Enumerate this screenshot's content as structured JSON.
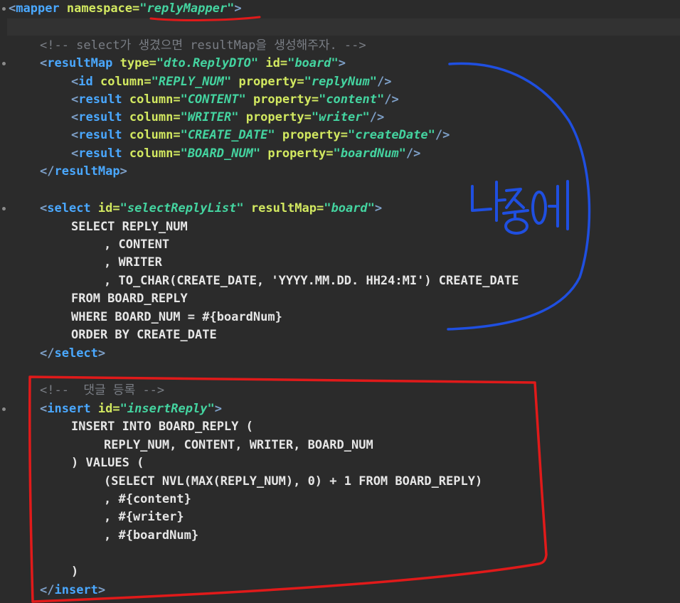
{
  "lines": [
    {
      "key": "mapper_open",
      "parts": [
        [
          "bracket",
          "<"
        ],
        [
          "tag",
          "mapper"
        ],
        [
          "attr",
          " namespace"
        ],
        [
          "eq",
          "="
        ],
        [
          "val",
          "\"replyMapper\""
        ],
        [
          "bracket",
          ">"
        ]
      ]
    },
    {
      "key": "comment_select",
      "parts": [
        [
          "comment",
          "<!-- select가 생겼으면 resultMap을 생성해주자. -->"
        ]
      ]
    },
    {
      "key": "resultmap_open",
      "parts": [
        [
          "bracket",
          "<"
        ],
        [
          "tag",
          "resultMap"
        ],
        [
          "attr",
          " type"
        ],
        [
          "eq",
          "="
        ],
        [
          "val",
          "\"dto.ReplyDTO\""
        ],
        [
          "attr",
          " id"
        ],
        [
          "eq",
          "="
        ],
        [
          "val",
          "\"board\""
        ],
        [
          "bracket",
          ">"
        ]
      ]
    },
    {
      "key": "id_line",
      "parts": [
        [
          "bracket",
          "<"
        ],
        [
          "tag",
          "id"
        ],
        [
          "attr",
          " column"
        ],
        [
          "eq",
          "="
        ],
        [
          "val",
          "\"REPLY_NUM\""
        ],
        [
          "attr",
          " property"
        ],
        [
          "eq",
          "="
        ],
        [
          "val",
          "\"replyNum\""
        ],
        [
          "bracket",
          "/>"
        ]
      ]
    },
    {
      "key": "result_content",
      "parts": [
        [
          "bracket",
          "<"
        ],
        [
          "tag",
          "result"
        ],
        [
          "attr",
          " column"
        ],
        [
          "eq",
          "="
        ],
        [
          "val",
          "\"CONTENT\""
        ],
        [
          "attr",
          " property"
        ],
        [
          "eq",
          "="
        ],
        [
          "val",
          "\"content\""
        ],
        [
          "bracket",
          "/>"
        ]
      ]
    },
    {
      "key": "result_writer",
      "parts": [
        [
          "bracket",
          "<"
        ],
        [
          "tag",
          "result"
        ],
        [
          "attr",
          " column"
        ],
        [
          "eq",
          "="
        ],
        [
          "val",
          "\"WRITER\""
        ],
        [
          "attr",
          " property"
        ],
        [
          "eq",
          "="
        ],
        [
          "val",
          "\"writer\""
        ],
        [
          "bracket",
          "/>"
        ]
      ]
    },
    {
      "key": "result_createdate",
      "parts": [
        [
          "bracket",
          "<"
        ],
        [
          "tag",
          "result"
        ],
        [
          "attr",
          " column"
        ],
        [
          "eq",
          "="
        ],
        [
          "val",
          "\"CREATE_DATE\""
        ],
        [
          "attr",
          " property"
        ],
        [
          "eq",
          "="
        ],
        [
          "val",
          "\"createDate\""
        ],
        [
          "bracket",
          "/>"
        ]
      ]
    },
    {
      "key": "result_boardnum",
      "parts": [
        [
          "bracket",
          "<"
        ],
        [
          "tag",
          "result"
        ],
        [
          "attr",
          " column"
        ],
        [
          "eq",
          "="
        ],
        [
          "val",
          "\"BOARD_NUM\""
        ],
        [
          "attr",
          " property"
        ],
        [
          "eq",
          "="
        ],
        [
          "val",
          "\"boardNum\""
        ],
        [
          "bracket",
          "/>"
        ]
      ]
    },
    {
      "key": "resultmap_close",
      "parts": [
        [
          "bracket",
          "</"
        ],
        [
          "tag",
          "resultMap"
        ],
        [
          "bracket",
          ">"
        ]
      ]
    },
    {
      "key": "select_open",
      "parts": [
        [
          "bracket",
          "<"
        ],
        [
          "tag",
          "select"
        ],
        [
          "attr",
          " id"
        ],
        [
          "eq",
          "="
        ],
        [
          "val",
          "\"selectReplyList\""
        ],
        [
          "attr",
          " resultMap"
        ],
        [
          "eq",
          "="
        ],
        [
          "val",
          "\"board\""
        ],
        [
          "bracket",
          ">"
        ]
      ]
    },
    {
      "key": "sql_select",
      "parts": [
        [
          "sql",
          "SELECT REPLY_NUM"
        ]
      ]
    },
    {
      "key": "sql_content",
      "parts": [
        [
          "sql",
          ", CONTENT"
        ]
      ]
    },
    {
      "key": "sql_writer",
      "parts": [
        [
          "sql",
          ", WRITER"
        ]
      ]
    },
    {
      "key": "sql_tochar",
      "parts": [
        [
          "sql",
          ", TO_CHAR(CREATE_DATE, 'YYYY.MM.DD. HH24:MI') CREATE_DATE"
        ]
      ]
    },
    {
      "key": "sql_from",
      "parts": [
        [
          "sql",
          "FROM BOARD_REPLY"
        ]
      ]
    },
    {
      "key": "sql_where",
      "parts": [
        [
          "sql",
          "WHERE BOARD_NUM = #{boardNum}"
        ]
      ]
    },
    {
      "key": "sql_order",
      "parts": [
        [
          "sql",
          "ORDER BY CREATE_DATE"
        ]
      ]
    },
    {
      "key": "select_close",
      "parts": [
        [
          "bracket",
          "</"
        ],
        [
          "tag",
          "select"
        ],
        [
          "bracket",
          ">"
        ]
      ]
    },
    {
      "key": "comment_insert",
      "parts": [
        [
          "comment",
          "<!--  댓글 등록 -->"
        ]
      ]
    },
    {
      "key": "insert_open",
      "parts": [
        [
          "bracket",
          "<"
        ],
        [
          "tag",
          "insert"
        ],
        [
          "attr",
          " id"
        ],
        [
          "eq",
          "="
        ],
        [
          "val",
          "\"insertReply\""
        ],
        [
          "bracket",
          ">"
        ]
      ]
    },
    {
      "key": "sql_insert",
      "parts": [
        [
          "sql",
          "INSERT INTO BOARD_REPLY ("
        ]
      ]
    },
    {
      "key": "sql_cols",
      "parts": [
        [
          "sql",
          "REPLY_NUM, CONTENT, WRITER, BOARD_NUM"
        ]
      ]
    },
    {
      "key": "sql_values",
      "parts": [
        [
          "sql",
          ") VALUES ("
        ]
      ]
    },
    {
      "key": "sql_subselect",
      "parts": [
        [
          "sql",
          "(SELECT NVL(MAX(REPLY_NUM), 0) + 1 FROM BOARD_REPLY)"
        ]
      ]
    },
    {
      "key": "sql_p_content",
      "parts": [
        [
          "sql",
          ", #{content}"
        ]
      ]
    },
    {
      "key": "sql_p_writer",
      "parts": [
        [
          "sql",
          ", #{writer}"
        ]
      ]
    },
    {
      "key": "sql_p_boardnum",
      "parts": [
        [
          "sql",
          ", #{boardNum}"
        ]
      ]
    },
    {
      "key": "sql_close_paren",
      "parts": [
        [
          "sql",
          ")"
        ]
      ]
    },
    {
      "key": "insert_close",
      "parts": [
        [
          "bracket",
          "</"
        ],
        [
          "tag",
          "insert"
        ],
        [
          "bracket",
          ">"
        ]
      ]
    }
  ],
  "annotation": {
    "handwritten_text": "나중에",
    "colors": {
      "blue": "#1f4fe0",
      "red": "#e01a1a"
    }
  }
}
